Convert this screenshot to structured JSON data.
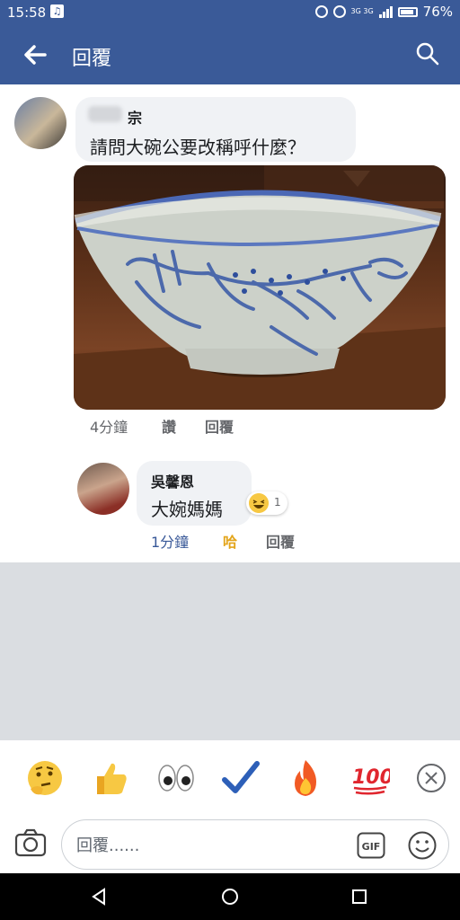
{
  "status_bar": {
    "time": "15:58",
    "battery": "76%",
    "network": "3G 3G"
  },
  "header": {
    "title": "回覆"
  },
  "comments": [
    {
      "author": "宗",
      "text": "請問大碗公要改稱呼什麼？",
      "time": "4分鐘",
      "action_like": "讚",
      "action_reply": "回覆"
    },
    {
      "author": "吳馨恩",
      "text": "大婉媽媽",
      "time": "1分鐘",
      "action_like": "哈",
      "action_reply": "回覆",
      "reaction_count": "1"
    }
  ],
  "reaction_emojis": [
    "thinking-face-icon",
    "thumbs-up-icon",
    "eyes-icon",
    "check-mark-icon",
    "fire-icon",
    "hundred-points-icon"
  ],
  "composer": {
    "placeholder": "回覆......",
    "gif_label": "GIF"
  },
  "colors": {
    "brand": "#3a5a98",
    "meta_text": "#65676b",
    "active_link": "#385898",
    "haha": "#e3a51b"
  }
}
